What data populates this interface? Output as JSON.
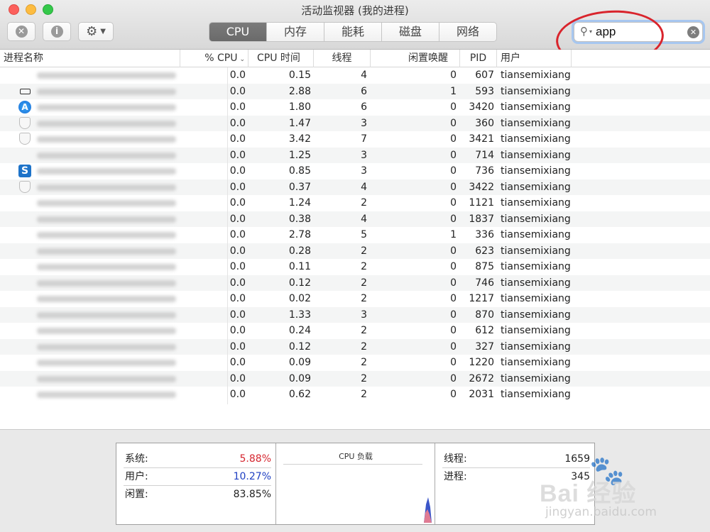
{
  "window": {
    "title": "活动监视器 (我的进程)"
  },
  "toolbar": {
    "stop_icon": "x-circle-icon",
    "info_icon": "info-icon",
    "gear_icon": "gear-icon"
  },
  "tabs": [
    {
      "label": "CPU",
      "active": true
    },
    {
      "label": "内存",
      "active": false
    },
    {
      "label": "能耗",
      "active": false
    },
    {
      "label": "磁盘",
      "active": false
    },
    {
      "label": "网络",
      "active": false
    }
  ],
  "search": {
    "value": "app"
  },
  "columns": {
    "name": "进程名称",
    "cpu": "% CPU",
    "cpu_time": "CPU 时间",
    "threads": "线程",
    "idle_wakeups": "闲置唤醒",
    "pid": "PID",
    "user": "用户"
  },
  "rows": [
    {
      "icon": "",
      "cpu": "0.0",
      "cpu_time": "0.15",
      "threads": "4",
      "idle": "0",
      "pid": "607",
      "user": "tiansemixiang"
    },
    {
      "icon": "device-icon",
      "cpu": "0.0",
      "cpu_time": "2.88",
      "threads": "6",
      "idle": "1",
      "pid": "593",
      "user": "tiansemixiang"
    },
    {
      "icon": "app-store-icon",
      "cpu": "0.0",
      "cpu_time": "1.80",
      "threads": "6",
      "idle": "0",
      "pid": "3420",
      "user": "tiansemixiang"
    },
    {
      "icon": "shield-icon",
      "cpu": "0.0",
      "cpu_time": "1.47",
      "threads": "3",
      "idle": "0",
      "pid": "360",
      "user": "tiansemixiang"
    },
    {
      "icon": "shield-icon",
      "cpu": "0.0",
      "cpu_time": "3.42",
      "threads": "7",
      "idle": "0",
      "pid": "3421",
      "user": "tiansemixiang"
    },
    {
      "icon": "",
      "cpu": "0.0",
      "cpu_time": "1.25",
      "threads": "3",
      "idle": "0",
      "pid": "714",
      "user": "tiansemixiang"
    },
    {
      "icon": "s-app-icon",
      "cpu": "0.0",
      "cpu_time": "0.85",
      "threads": "3",
      "idle": "0",
      "pid": "736",
      "user": "tiansemixiang"
    },
    {
      "icon": "shield-icon",
      "cpu": "0.0",
      "cpu_time": "0.37",
      "threads": "4",
      "idle": "0",
      "pid": "3422",
      "user": "tiansemixiang"
    },
    {
      "icon": "",
      "cpu": "0.0",
      "cpu_time": "1.24",
      "threads": "2",
      "idle": "0",
      "pid": "1121",
      "user": "tiansemixiang"
    },
    {
      "icon": "",
      "cpu": "0.0",
      "cpu_time": "0.38",
      "threads": "4",
      "idle": "0",
      "pid": "1837",
      "user": "tiansemixiang"
    },
    {
      "icon": "",
      "cpu": "0.0",
      "cpu_time": "2.78",
      "threads": "5",
      "idle": "1",
      "pid": "336",
      "user": "tiansemixiang"
    },
    {
      "icon": "",
      "cpu": "0.0",
      "cpu_time": "0.28",
      "threads": "2",
      "idle": "0",
      "pid": "623",
      "user": "tiansemixiang"
    },
    {
      "icon": "",
      "cpu": "0.0",
      "cpu_time": "0.11",
      "threads": "2",
      "idle": "0",
      "pid": "875",
      "user": "tiansemixiang"
    },
    {
      "icon": "",
      "cpu": "0.0",
      "cpu_time": "0.12",
      "threads": "2",
      "idle": "0",
      "pid": "746",
      "user": "tiansemixiang"
    },
    {
      "icon": "",
      "cpu": "0.0",
      "cpu_time": "0.02",
      "threads": "2",
      "idle": "0",
      "pid": "1217",
      "user": "tiansemixiang"
    },
    {
      "icon": "",
      "cpu": "0.0",
      "cpu_time": "1.33",
      "threads": "3",
      "idle": "0",
      "pid": "870",
      "user": "tiansemixiang"
    },
    {
      "icon": "",
      "cpu": "0.0",
      "cpu_time": "0.24",
      "threads": "2",
      "idle": "0",
      "pid": "612",
      "user": "tiansemixiang"
    },
    {
      "icon": "",
      "cpu": "0.0",
      "cpu_time": "0.12",
      "threads": "2",
      "idle": "0",
      "pid": "327",
      "user": "tiansemixiang"
    },
    {
      "icon": "",
      "cpu": "0.0",
      "cpu_time": "0.09",
      "threads": "2",
      "idle": "0",
      "pid": "1220",
      "user": "tiansemixiang"
    },
    {
      "icon": "",
      "cpu": "0.0",
      "cpu_time": "0.09",
      "threads": "2",
      "idle": "0",
      "pid": "2672",
      "user": "tiansemixiang"
    },
    {
      "icon": "",
      "cpu": "0.0",
      "cpu_time": "0.62",
      "threads": "2",
      "idle": "0",
      "pid": "2031",
      "user": "tiansemixiang"
    }
  ],
  "stats": {
    "system": {
      "label": "系统:",
      "value": "5.88%"
    },
    "user": {
      "label": "用户:",
      "value": "10.27%"
    },
    "idle": {
      "label": "闲置:",
      "value": "83.85%"
    },
    "load_title": "CPU 负载",
    "threads": {
      "label": "线程:",
      "value": "1659"
    },
    "processes": {
      "label": "进程:",
      "value": "345"
    }
  },
  "watermark": {
    "text": "Bai 经验",
    "url": "jingyan.baidu.com"
  },
  "colors": {
    "system": "#d5262f",
    "user": "#1e3fc2",
    "highlight_ring": "#d9242c",
    "tab_active": "#6e6e6e"
  }
}
